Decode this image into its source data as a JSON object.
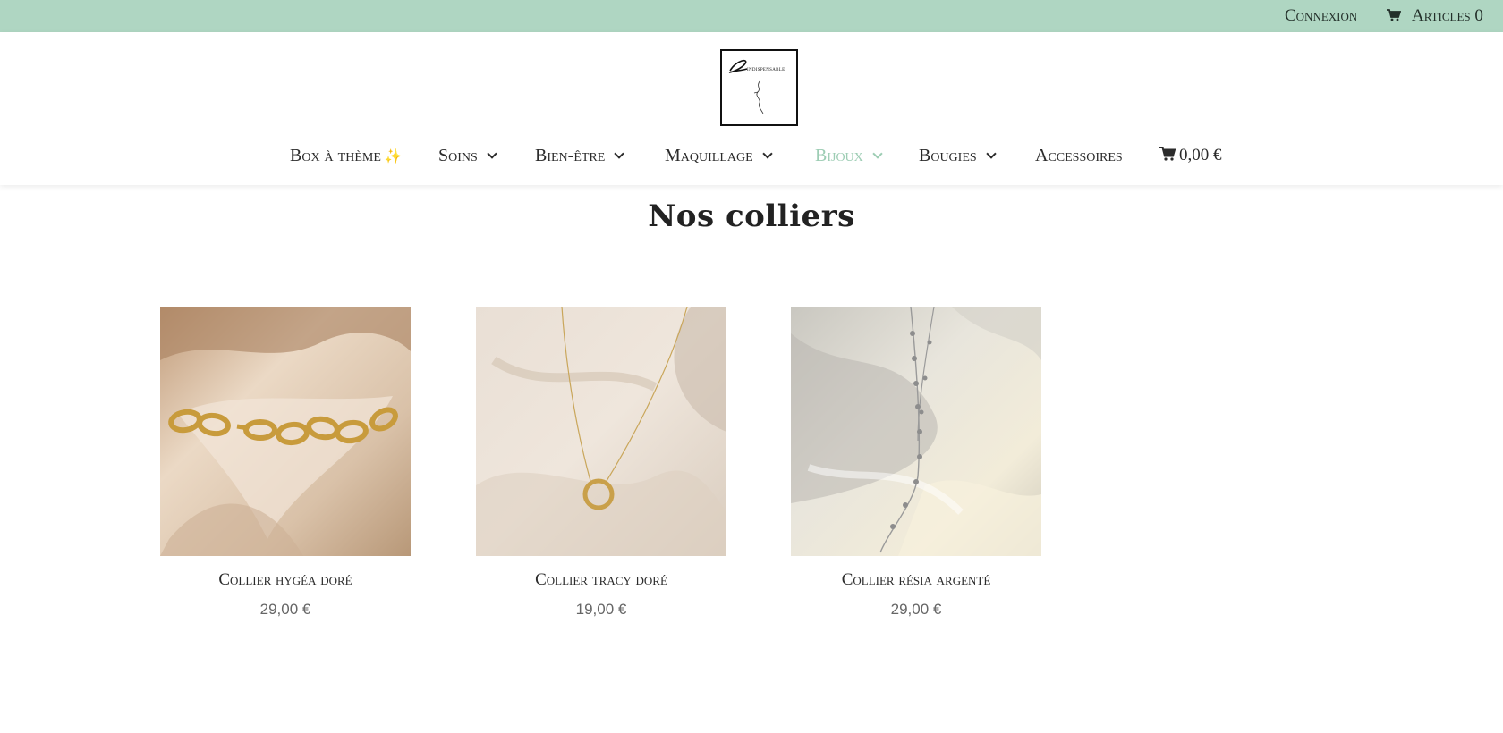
{
  "topbar": {
    "login_label": "Connexion",
    "cart_label": "Articles 0"
  },
  "brand": {
    "logo_text": "indispensable"
  },
  "nav": {
    "items": [
      {
        "label": "Box à thème",
        "sparkle": "✨"
      },
      {
        "label": "Soins"
      },
      {
        "label": "Bien-être"
      },
      {
        "label": "Maquillage"
      },
      {
        "label": "Bijoux"
      },
      {
        "label": "Bougies"
      },
      {
        "label": "Accessoires"
      }
    ],
    "cart_total": "0,00 €"
  },
  "page": {
    "title": "Nos colliers"
  },
  "products": [
    {
      "name": "Collier hygéa doré",
      "price": "29,00 €"
    },
    {
      "name": "Collier tracy doré",
      "price": "19,00 €"
    },
    {
      "name": "Collier résia argenté",
      "price": "29,00 €"
    }
  ],
  "colors": {
    "topbar_bg": "#afd6c2",
    "active_nav": "#9dcdb4",
    "text": "#2b2b2b"
  },
  "icons": {
    "cart": "cart-icon",
    "chevron": "chevron-down-icon",
    "sparkle": "sparkle-icon"
  }
}
